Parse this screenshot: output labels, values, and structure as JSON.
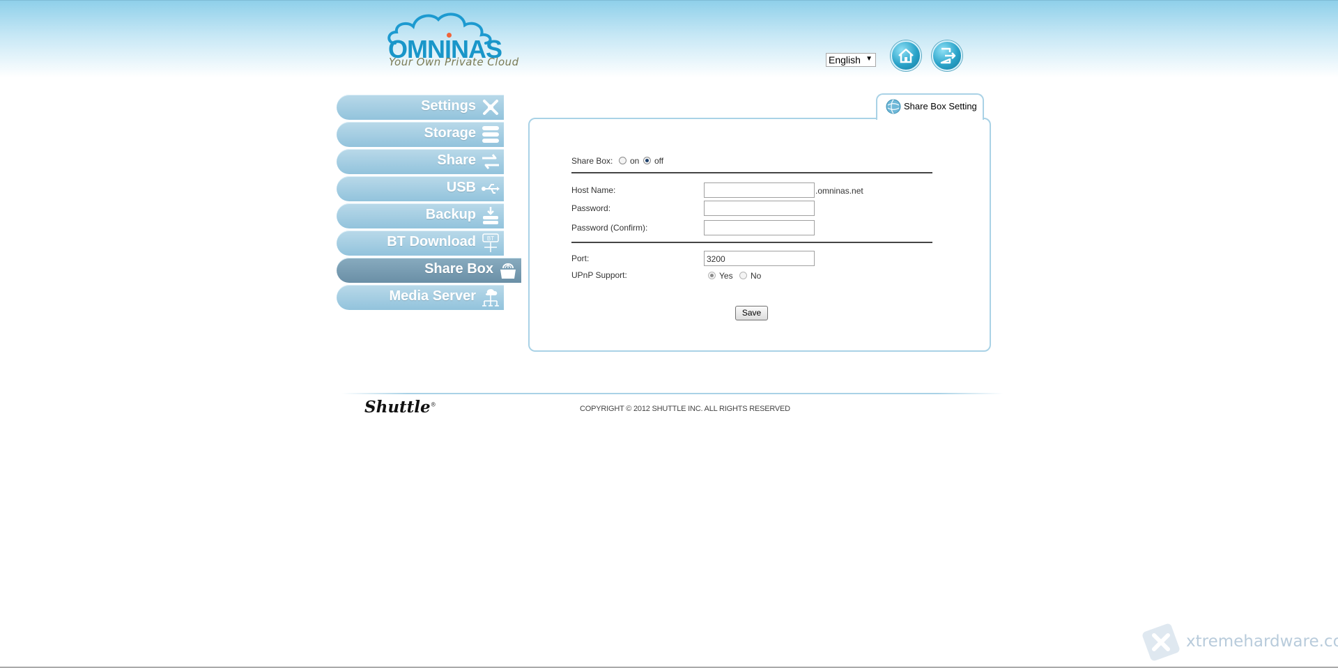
{
  "header": {
    "logo_text": "OMNINAS",
    "logo_tagline": "Your Own Private Cloud",
    "language": "English",
    "home_icon": "home-icon",
    "logout_icon": "logout-icon"
  },
  "nav": {
    "items": [
      {
        "label": "Settings",
        "icon": "tools-icon"
      },
      {
        "label": "Storage",
        "icon": "storage-icon"
      },
      {
        "label": "Share",
        "icon": "share-arrows-icon"
      },
      {
        "label": "USB",
        "icon": "usb-icon"
      },
      {
        "label": "Backup",
        "icon": "backup-icon"
      },
      {
        "label": "BT Download",
        "icon": "bt-download-icon"
      },
      {
        "label": "Share Box",
        "icon": "share-box-icon",
        "active": true
      },
      {
        "label": "Media Server",
        "icon": "media-server-icon"
      }
    ],
    "colors": {
      "normal": "#a6cfe3",
      "active": "#7a9fb5"
    }
  },
  "panel": {
    "tab_label": "Share Box Setting",
    "share_box": {
      "label": "Share Box:",
      "option_on": "on",
      "option_off": "off",
      "selected": "off"
    },
    "host_name": {
      "label": "Host Name:",
      "value": "",
      "suffix": ".omninas.net"
    },
    "password": {
      "label": "Password:",
      "value": ""
    },
    "password_confirm": {
      "label": "Password (Confirm):",
      "value": ""
    },
    "port": {
      "label": "Port:",
      "value": "3200"
    },
    "upnp": {
      "label": "UPnP Support:",
      "option_yes": "Yes",
      "option_no": "No",
      "selected": "Yes"
    },
    "save_label": "Save"
  },
  "footer": {
    "brand": "Shuttle",
    "copyright": "COPYRIGHT © 2012 SHUTTLE INC. ALL RIGHTS RESERVED"
  },
  "watermark": {
    "text": "xtremehardware.com"
  }
}
